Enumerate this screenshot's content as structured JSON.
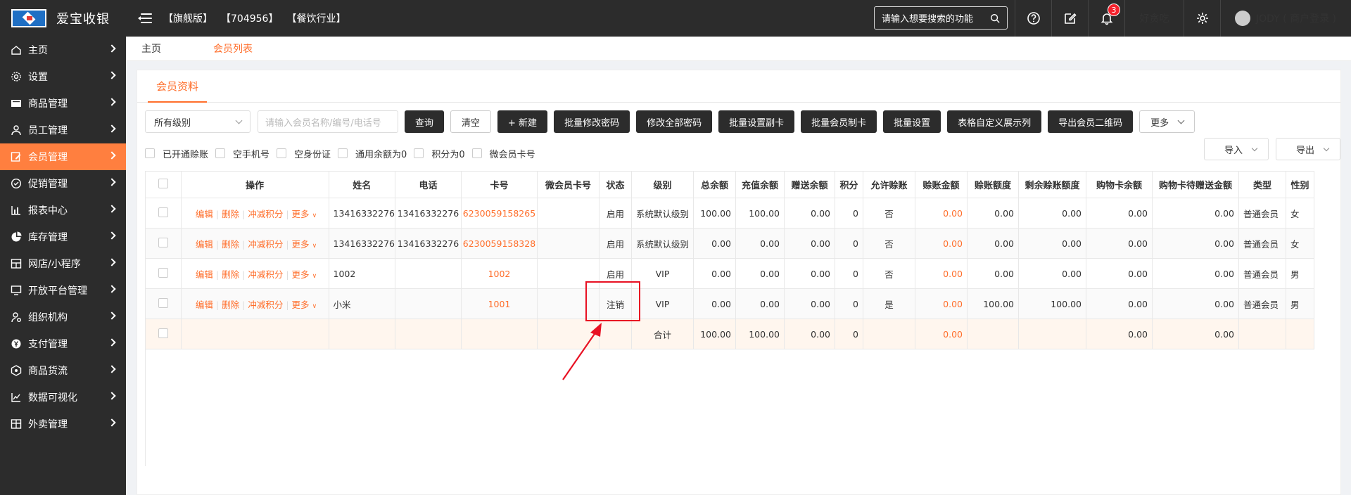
{
  "app": {
    "name": "爱宝收银",
    "edition": [
      "【旗舰版】",
      "【704956】",
      "【餐饮行业】"
    ],
    "search_placeholder": "请输入想要搜索的功能",
    "notification_count": "3",
    "shop_name": "好贪吃",
    "user": "JODY ( 商户登录 )"
  },
  "sidebar": {
    "items": [
      {
        "label": "主页",
        "icon": "home-icon"
      },
      {
        "label": "设置",
        "icon": "gear-icon"
      },
      {
        "label": "商品管理",
        "icon": "box-icon"
      },
      {
        "label": "员工管理",
        "icon": "user-icon"
      },
      {
        "label": "会员管理",
        "icon": "edit-icon",
        "active": true
      },
      {
        "label": "促销管理",
        "icon": "check-circle-icon"
      },
      {
        "label": "报表中心",
        "icon": "bar-chart-icon"
      },
      {
        "label": "库存管理",
        "icon": "pie-chart-icon"
      },
      {
        "label": "网店/小程序",
        "icon": "store-icon"
      },
      {
        "label": "开放平台管理",
        "icon": "monitor-icon"
      },
      {
        "label": "组织机构",
        "icon": "org-icon"
      },
      {
        "label": "支付管理",
        "icon": "yen-icon"
      },
      {
        "label": "商品货流",
        "icon": "flow-icon"
      },
      {
        "label": "数据可视化",
        "icon": "line-chart-icon"
      },
      {
        "label": "外卖管理",
        "icon": "delivery-icon"
      }
    ]
  },
  "tabs": {
    "home": "主页",
    "current": "会员列表"
  },
  "panel": {
    "tab": "会员资料"
  },
  "toolbar": {
    "level_select": "所有级别",
    "search_placeholder": "请输入会员名称/编号/电话号",
    "buttons": [
      "查询",
      "清空",
      "+ 新建",
      "批量修改密码",
      "修改全部密码",
      "批量设置副卡",
      "批量会员制卡",
      "批量设置",
      "表格自定义展示列",
      "导出会员二维码",
      "更多"
    ]
  },
  "filters": [
    "已开通赊账",
    "空手机号",
    "空身份证",
    "通用余额为0",
    "积分为0",
    "微会员卡号"
  ],
  "io": {
    "import": "导入",
    "export": "导出"
  },
  "table": {
    "headers": [
      "操作",
      "姓名",
      "电话",
      "卡号",
      "微会员卡号",
      "状态",
      "级别",
      "总余额",
      "充值余额",
      "赠送余额",
      "积分",
      "允许赊账",
      "赊账金额",
      "赊账额度",
      "剩余赊账额度",
      "购物卡余额",
      "购物卡待赠送金额",
      "类型",
      "性别"
    ],
    "ops": [
      "编辑",
      "删除",
      "冲减积分",
      "更多"
    ],
    "rows": [
      {
        "name": "13416332276",
        "phone": "13416332276",
        "card": "6230059158265",
        "wx": "",
        "status": "启用",
        "level": "系统默认级别",
        "total": "100.00",
        "recharge": "100.00",
        "gift": "0.00",
        "points": "0",
        "credit": "否",
        "credit_amt": "0.00",
        "credit_limit": "0.00",
        "credit_left": "0.00",
        "shopcard": "0.00",
        "shopcard_gift": "0.00",
        "type": "普通会员",
        "gender": "女"
      },
      {
        "name": "13416332276",
        "phone": "13416332276",
        "card": "6230059158328",
        "wx": "",
        "status": "启用",
        "level": "系统默认级别",
        "total": "0.00",
        "recharge": "0.00",
        "gift": "0.00",
        "points": "0",
        "credit": "否",
        "credit_amt": "0.00",
        "credit_limit": "0.00",
        "credit_left": "0.00",
        "shopcard": "0.00",
        "shopcard_gift": "0.00",
        "type": "普通会员",
        "gender": "女"
      },
      {
        "name": "1002",
        "phone": "",
        "card": "1002",
        "wx": "",
        "status": "启用",
        "level": "VIP",
        "total": "0.00",
        "recharge": "0.00",
        "gift": "0.00",
        "points": "0",
        "credit": "否",
        "credit_amt": "0.00",
        "credit_limit": "0.00",
        "credit_left": "0.00",
        "shopcard": "0.00",
        "shopcard_gift": "0.00",
        "type": "普通会员",
        "gender": "男"
      },
      {
        "name": "小米",
        "phone": "",
        "card": "1001",
        "wx": "",
        "status": "注销",
        "level": "VIP",
        "total": "0.00",
        "recharge": "0.00",
        "gift": "0.00",
        "points": "0",
        "credit": "是",
        "credit_amt": "0.00",
        "credit_limit": "100.00",
        "credit_left": "100.00",
        "shopcard": "0.00",
        "shopcard_gift": "0.00",
        "type": "普通会员",
        "gender": "男"
      }
    ],
    "summary": {
      "label": "合计",
      "total": "100.00",
      "recharge": "100.00",
      "gift": "0.00",
      "points": "0",
      "credit_amt": "0.00",
      "shopcard": "0.00",
      "shopcard_gift": "0.00"
    }
  },
  "colors": {
    "accent": "#ff6f2c",
    "dark": "#2c2c2c",
    "highlight": "#e81123"
  }
}
